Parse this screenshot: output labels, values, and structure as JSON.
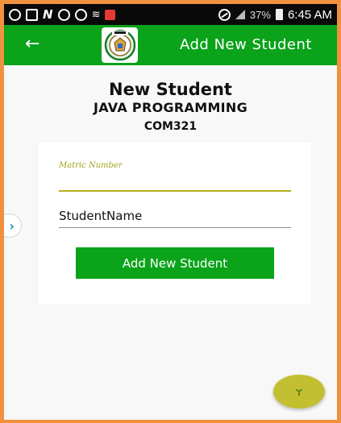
{
  "status_bar": {
    "battery_text": "37%",
    "time": "6:45 AM"
  },
  "app_bar": {
    "back_icon": "arrow-left-icon",
    "title": "Add New Student"
  },
  "header": {
    "title": "New Student",
    "course": "JAVA PROGRAMMING",
    "code": "COM321"
  },
  "form": {
    "matric_label": "Matric Number",
    "matric_value": "",
    "name_value": "StudentName",
    "submit_label": "Add New Student"
  },
  "colors": {
    "primary": "#0aa31a",
    "accent": "#b5b21a",
    "fab": "#c4bf31",
    "frame": "#f0913f"
  }
}
